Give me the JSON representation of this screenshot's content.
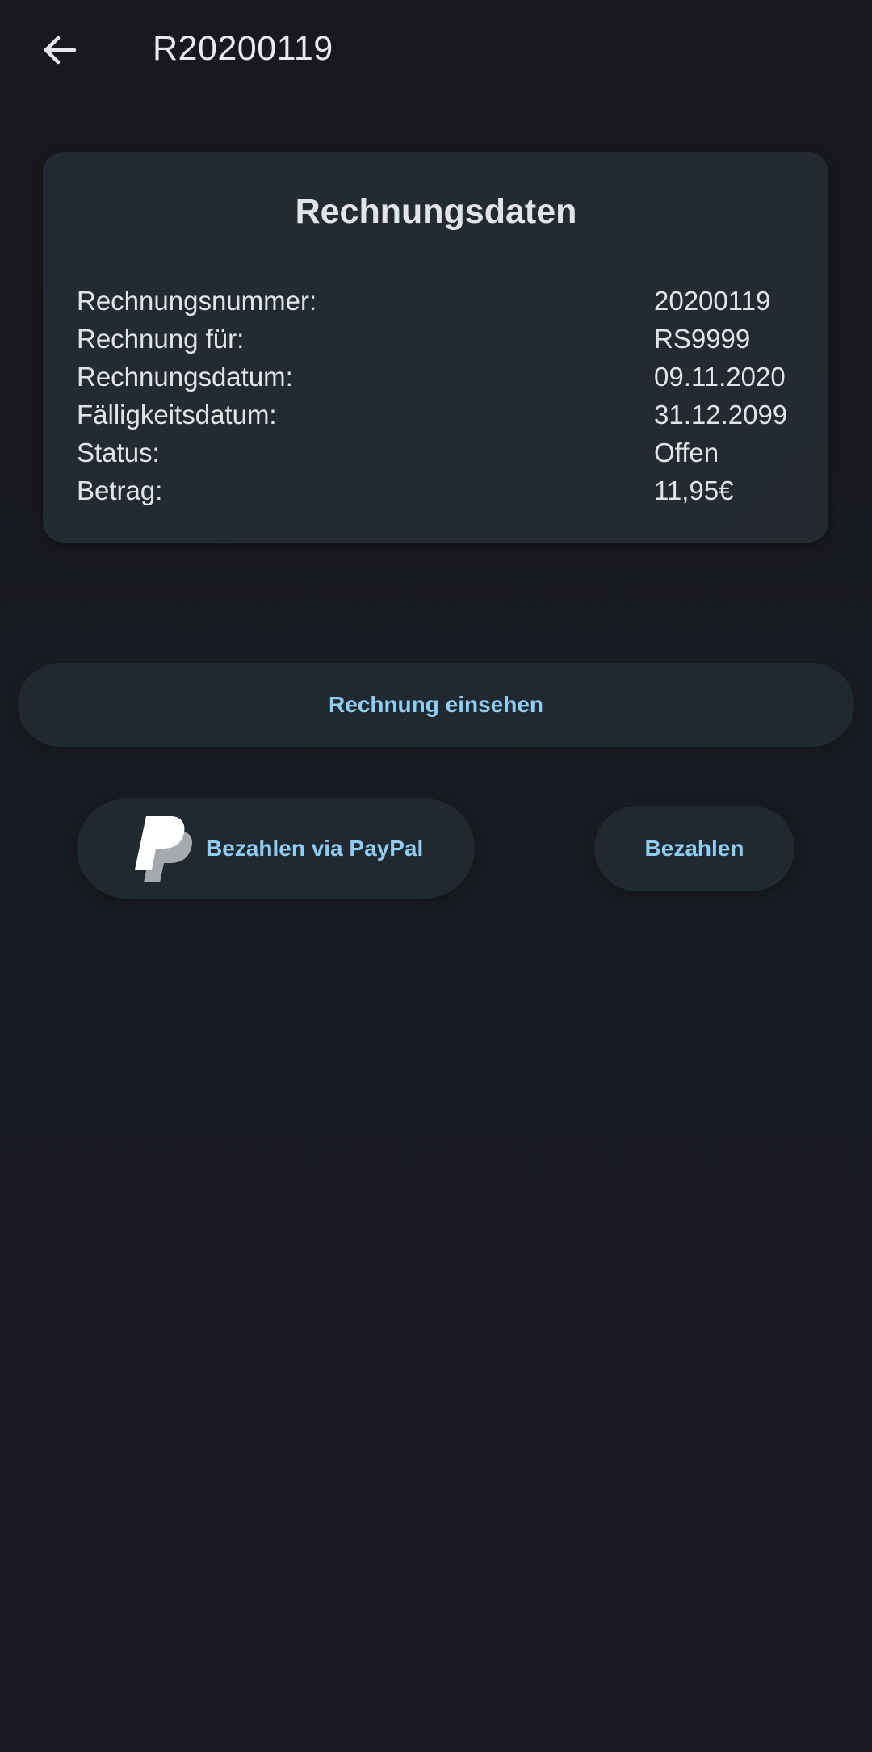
{
  "header": {
    "title": "R20200119"
  },
  "card": {
    "title": "Rechnungsdaten",
    "rows": [
      {
        "label": "Rechnungsnummer:",
        "value": "20200119"
      },
      {
        "label": "Rechnung für:",
        "value": "RS9999"
      },
      {
        "label": "Rechnungsdatum:",
        "value": "09.11.2020"
      },
      {
        "label": "Fälligkeitsdatum:",
        "value": "31.12.2099"
      },
      {
        "label": "Status:",
        "value": "Offen"
      },
      {
        "label": "Betrag:",
        "value": "11,95€"
      }
    ]
  },
  "actions": {
    "view_invoice_label": "Rechnung einsehen",
    "paypal_label": "Bezahlen via PayPal",
    "pay_label": "Bezahlen"
  },
  "icons": {
    "back": "arrow-left-icon",
    "paypal": "paypal-logo-icon"
  },
  "colors": {
    "accent": "#8fcdf4",
    "card_background": "#222a32",
    "page_background": "#191b22"
  }
}
